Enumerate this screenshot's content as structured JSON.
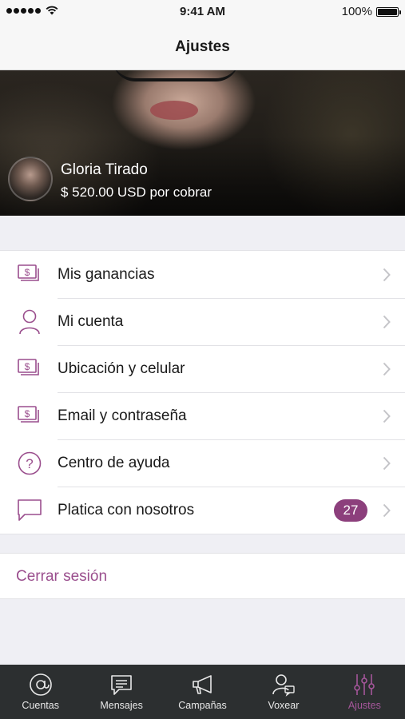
{
  "status_bar": {
    "time": "9:41 AM",
    "battery": "100%"
  },
  "nav": {
    "title": "Ajustes"
  },
  "profile": {
    "name": "Gloria Tirado",
    "balance": "$ 520.00 USD por cobrar"
  },
  "menu": [
    {
      "label": "Mis ganancias",
      "icon": "money-icon"
    },
    {
      "label": "Mi cuenta",
      "icon": "user-icon"
    },
    {
      "label": "Ubicación y celular",
      "icon": "money-icon"
    },
    {
      "label": "Email y contraseña",
      "icon": "money-icon"
    },
    {
      "label": "Centro de ayuda",
      "icon": "help-icon"
    },
    {
      "label": "Platica con nosotros",
      "icon": "chat-icon",
      "badge": "27"
    }
  ],
  "logout": {
    "label": "Cerrar sesión"
  },
  "tabs": [
    {
      "label": "Cuentas",
      "icon": "at-icon",
      "active": false
    },
    {
      "label": "Mensajes",
      "icon": "messages-icon",
      "active": false
    },
    {
      "label": "Campañas",
      "icon": "megaphone-icon",
      "active": false
    },
    {
      "label": "Voxear",
      "icon": "voxear-icon",
      "active": false
    },
    {
      "label": "Ajustes",
      "icon": "sliders-icon",
      "active": true
    }
  ],
  "colors": {
    "accent": "#8c3f7c",
    "accent_text": "#9a4e8d",
    "tab_bar": "#2c2f30",
    "active_tab": "#a5569a"
  }
}
